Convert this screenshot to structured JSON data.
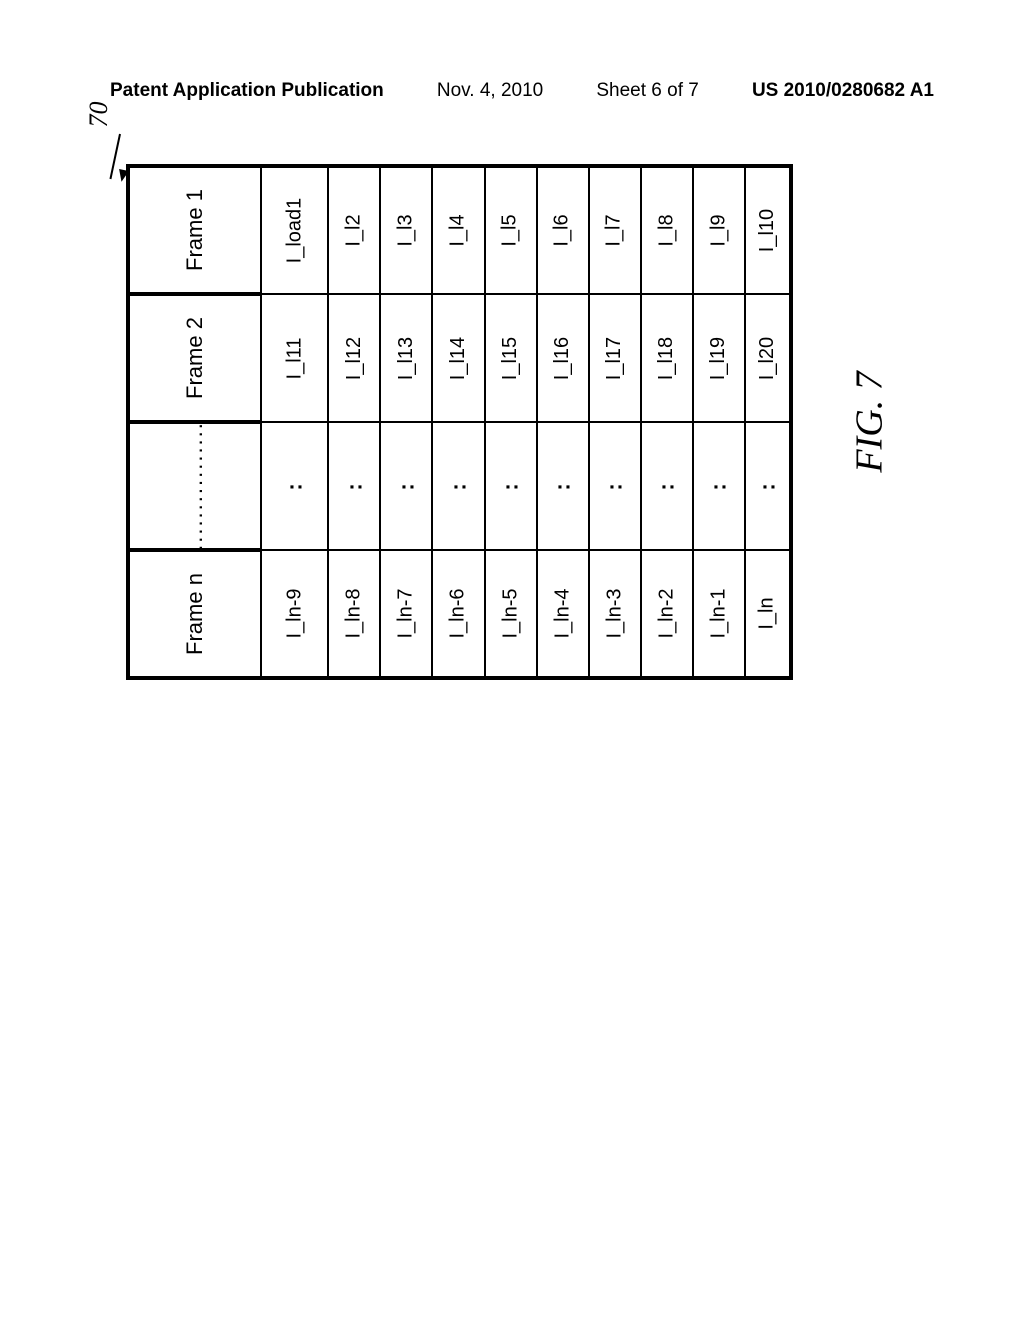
{
  "header": {
    "pub": "Patent Application Publication",
    "date": "Nov. 4, 2010",
    "sheet": "Sheet 6 of 7",
    "docnum": "US 2010/0280682 A1"
  },
  "ref_number": "70",
  "figure_caption": "FIG. 7",
  "table": {
    "rows": [
      {
        "header": "Frame 1",
        "cells": [
          "I_load1",
          "I_l2",
          "I_l3",
          "I_l4",
          "I_l5",
          "I_l6",
          "I_l7",
          "I_l8",
          "I_l9",
          "I_l10"
        ]
      },
      {
        "header": "Frame 2",
        "cells": [
          "I_l11",
          "I_l12",
          "I_l13",
          "I_l14",
          "I_l15",
          "I_l16",
          "I_l17",
          "I_l18",
          "I_l19",
          "I_l20"
        ]
      },
      {
        "header": "................",
        "cells": [
          ":",
          ":",
          ":",
          ":",
          ":",
          ":",
          ":",
          ":",
          ":",
          ":"
        ]
      },
      {
        "header": "Frame n",
        "cells": [
          "I_ln-9",
          "I_ln-8",
          "I_ln-7",
          "I_ln-6",
          "I_ln-5",
          "I_ln-4",
          "I_ln-3",
          "I_ln-2",
          "I_ln-1",
          "I_ln"
        ]
      }
    ]
  }
}
